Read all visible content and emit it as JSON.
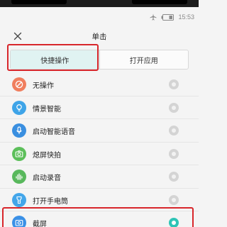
{
  "status": {
    "time": "15:53",
    "icons": [
      "airplane-icon",
      "battery-icon"
    ]
  },
  "header": {
    "title": "单击",
    "close_icon": "close-icon"
  },
  "tabs": [
    {
      "label": "快捷操作",
      "active": true
    },
    {
      "label": "打开应用",
      "active": false
    }
  ],
  "options": [
    {
      "label": "无操作",
      "icon": "no-action-icon",
      "color": "#f07e5e",
      "selected": false
    },
    {
      "label": "情景智能",
      "icon": "bulb-icon",
      "color": "#3ea4e8",
      "selected": false
    },
    {
      "label": "启动智能语音",
      "icon": "microphone-icon",
      "color": "#3a8fe0",
      "selected": false
    },
    {
      "label": "熄屏快拍",
      "icon": "camera-icon",
      "color": "#5cbf5a",
      "selected": false
    },
    {
      "label": "启动录音",
      "icon": "audio-recorder-icon",
      "color": "#58b85c",
      "selected": false
    },
    {
      "label": "打开手电筒",
      "icon": "flashlight-icon",
      "color": "#43a6ea",
      "selected": false
    },
    {
      "label": "截屏",
      "icon": "screenshot-icon",
      "color": "#3a90e6",
      "selected": true
    }
  ],
  "colors": {
    "accent": "#2ec4b6",
    "highlight": "#d8262b",
    "active_tab_bg": "#e0f3f2"
  }
}
